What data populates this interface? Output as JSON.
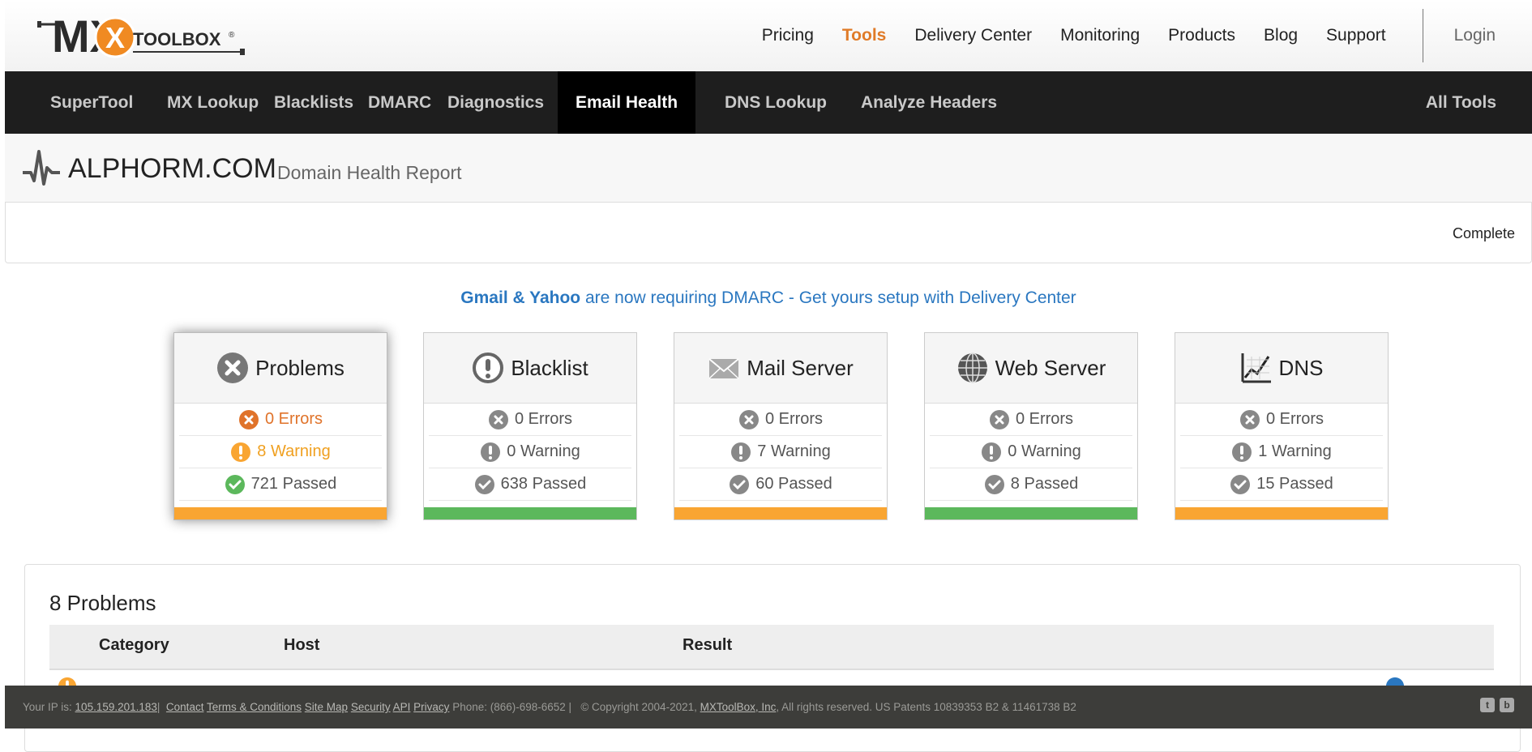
{
  "logo": {
    "text": "TOOLBOX",
    "letters": "MX",
    "reg": "®"
  },
  "topnav": {
    "items": [
      "Pricing",
      "Tools",
      "Delivery Center",
      "Monitoring",
      "Products",
      "Blog",
      "Support"
    ],
    "active": "Tools",
    "login": "Login"
  },
  "mainnav": {
    "items": [
      "SuperTool",
      "MX Lookup",
      "Blacklists",
      "DMARC",
      "Diagnostics",
      "Email Health",
      "DNS Lookup",
      "Analyze Headers"
    ],
    "active": "Email Health",
    "all_tools": "All Tools"
  },
  "report": {
    "domain": "ALPHORM.COM",
    "subtitle": "Domain Health Report",
    "status": "Complete"
  },
  "banner": {
    "highlight": "Gmail & Yahoo",
    "text": " are now requiring DMARC - Get yours setup with Delivery Center"
  },
  "cards": [
    {
      "title": "Problems",
      "icon": "x-circle-icon",
      "errors": "0 Errors",
      "warnings": "8 Warning",
      "passed": "721 Passed",
      "bar_color": "#f9a532",
      "active": true
    },
    {
      "title": "Blacklist",
      "icon": "exclamation-circle-icon",
      "errors": "0 Errors",
      "warnings": "0 Warning",
      "passed": "638 Passed",
      "bar_color": "#5cb85c"
    },
    {
      "title": "Mail Server",
      "icon": "envelope-icon",
      "errors": "0 Errors",
      "warnings": "7 Warning",
      "passed": "60 Passed",
      "bar_color": "#f9a532"
    },
    {
      "title": "Web Server",
      "icon": "globe-icon",
      "errors": "0 Errors",
      "warnings": "0 Warning",
      "passed": "8 Passed",
      "bar_color": "#5cb85c"
    },
    {
      "title": "DNS",
      "icon": "chart-icon",
      "errors": "0 Errors",
      "warnings": "1 Warning",
      "passed": "15 Passed",
      "bar_color": "#f9a532"
    }
  ],
  "problems": {
    "heading": "8 Problems",
    "columns": [
      "Category",
      "Host",
      "Result"
    ]
  },
  "footer": {
    "ip_label": "Your IP is: ",
    "ip": "105.159.201.183",
    "links": [
      "Contact",
      "Terms & Conditions",
      "Site Map",
      "Security",
      "API",
      "Privacy"
    ],
    "phone": "Phone: (866)-698-6652 |",
    "copyright": "© Copyright 2004-2021,",
    "company": "MXToolBox, Inc",
    "rights": ", All rights reserved. US Patents 10839353 B2 & 11461738 B2"
  },
  "colors": {
    "accent_orange": "#e07b28",
    "link_blue": "#2a77c0",
    "nav_dark": "#1e1e1e",
    "warn": "#f9a532",
    "ok": "#5cb85c"
  }
}
